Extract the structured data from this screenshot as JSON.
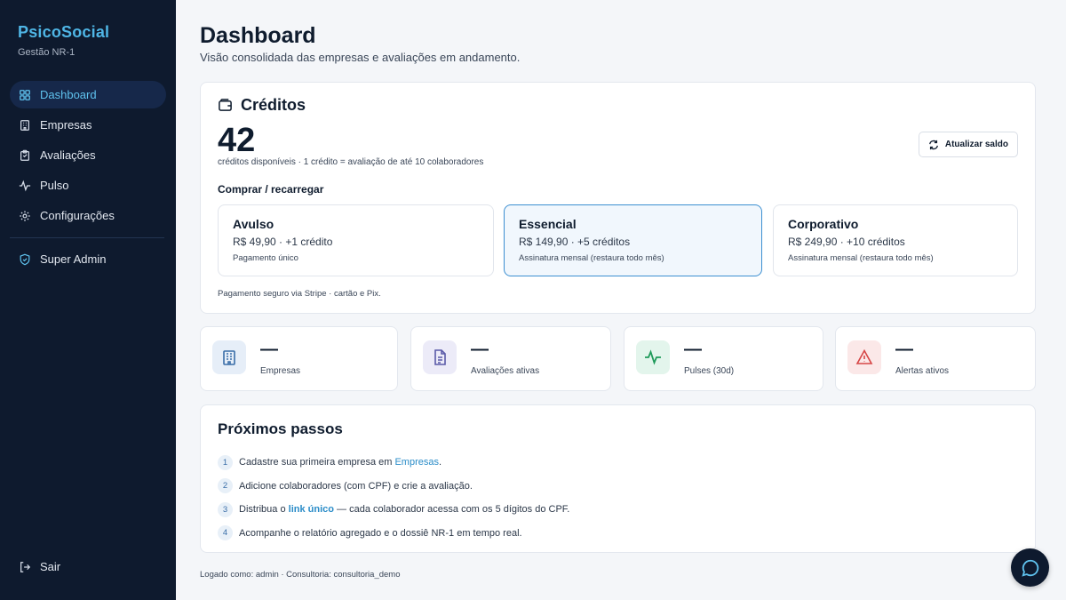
{
  "brand": {
    "title": "PsicoSocial",
    "subtitle": "Gestão NR-1"
  },
  "sidebar": {
    "items": [
      {
        "label": "Dashboard",
        "icon": "dashboard-grid-icon",
        "active": true
      },
      {
        "label": "Empresas",
        "icon": "building-icon"
      },
      {
        "label": "Avaliações",
        "icon": "clipboard-icon"
      },
      {
        "label": "Pulso",
        "icon": "pulse-icon"
      },
      {
        "label": "Configurações",
        "icon": "gear-icon"
      }
    ],
    "admin": {
      "label": "Super Admin",
      "icon": "shield-icon"
    },
    "logout": {
      "label": "Sair",
      "icon": "logout-icon"
    }
  },
  "header": {
    "title": "Dashboard",
    "subtitle": "Visão consolidada das empresas e avaliações em andamento."
  },
  "credits": {
    "title": "Créditos",
    "amount": "42",
    "description": "créditos disponíveis · 1 crédito = avaliação de até 10 colaboradores",
    "refresh_label": "Atualizar saldo",
    "buy_title": "Comprar / recarregar",
    "plans": [
      {
        "name": "Avulso",
        "price": "R$ 49,90 · +1 crédito",
        "note": "Pagamento único",
        "selected": false
      },
      {
        "name": "Essencial",
        "price": "R$ 149,90 · +5 créditos",
        "note": "Assinatura mensal (restaura todo mês)",
        "selected": true
      },
      {
        "name": "Corporativo",
        "price": "R$ 249,90 · +10 créditos",
        "note": "Assinatura mensal (restaura todo mês)",
        "selected": false
      }
    ],
    "secure_note": "Pagamento seguro via Stripe · cartão e Pix."
  },
  "stats": [
    {
      "value": "—",
      "label": "Empresas",
      "icon": "building-icon",
      "color": "#3a6ea8",
      "bg": "#e6eef8"
    },
    {
      "value": "—",
      "label": "Avaliações ativas",
      "icon": "document-icon",
      "color": "#5a5aa8",
      "bg": "#ecebf8"
    },
    {
      "value": "—",
      "label": "Pulses (30d)",
      "icon": "pulse-icon",
      "color": "#1f9a5a",
      "bg": "#e3f5ec"
    },
    {
      "value": "—",
      "label": "Alertas ativos",
      "icon": "warning-icon",
      "color": "#d64545",
      "bg": "#fbe8e8"
    }
  ],
  "next_steps": {
    "title": "Próximos passos",
    "steps": [
      {
        "num": "1",
        "before": "Cadastre sua primeira empresa em ",
        "link": "Empresas",
        "after": "."
      },
      {
        "num": "2",
        "before": "Adicione colaboradores (com CPF) e crie a avaliação.",
        "link": "",
        "after": ""
      },
      {
        "num": "3",
        "before": "Distribua o ",
        "link": "link único",
        "after": " — cada colaborador acessa com os 5 dígitos do CPF."
      },
      {
        "num": "4",
        "before": "Acompanhe o relatório agregado e o dossiê NR-1 em tempo real.",
        "link": "",
        "after": ""
      }
    ]
  },
  "footer": {
    "info": "Logado como: admin · Consultoria: consultoria_demo"
  },
  "chat": {
    "icon": "chat-bubble-icon"
  },
  "colors": {
    "sidebar_bg": "#0e1a2e",
    "accent": "#4fb6e6",
    "selected_border": "#3c8fd1"
  }
}
